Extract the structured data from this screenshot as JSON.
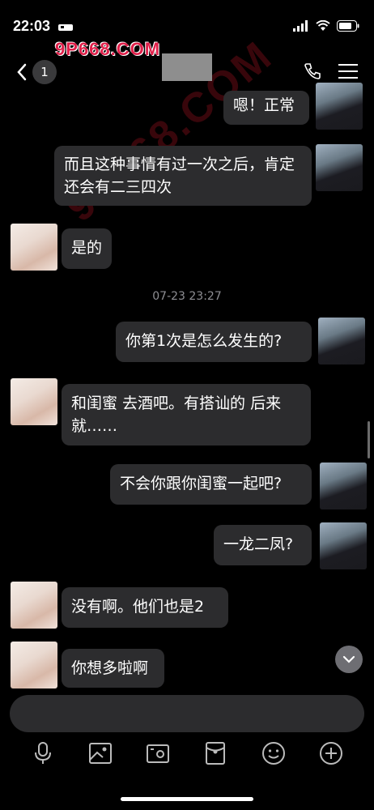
{
  "status_bar": {
    "time": "22:03"
  },
  "watermark": {
    "logo": "9P668.COM",
    "diagonal": "9P668.COM"
  },
  "header": {
    "back_count": "1"
  },
  "timestamp": "07-23 23:27",
  "messages": [
    {
      "sender": "me",
      "text": "嗯！正常"
    },
    {
      "sender": "me",
      "text": "而且这种事情有过一次之后，肯定还会有二三四次"
    },
    {
      "sender": "her",
      "text": "是的"
    },
    {
      "sender": "me",
      "text": "你第1次是怎么发生的?"
    },
    {
      "sender": "her",
      "text": "和闺蜜 去酒吧。有搭讪的 后来就……"
    },
    {
      "sender": "me",
      "text": "不会你跟你闺蜜一起吧?"
    },
    {
      "sender": "me",
      "text": "一龙二凤?"
    },
    {
      "sender": "her",
      "text": "没有啊。他们也是2"
    },
    {
      "sender": "her",
      "text": "你想多啦啊"
    }
  ],
  "toolbar_icons": [
    "microphone-icon",
    "image-icon",
    "camera-icon",
    "red-packet-icon",
    "emoji-icon",
    "plus-icon"
  ]
}
